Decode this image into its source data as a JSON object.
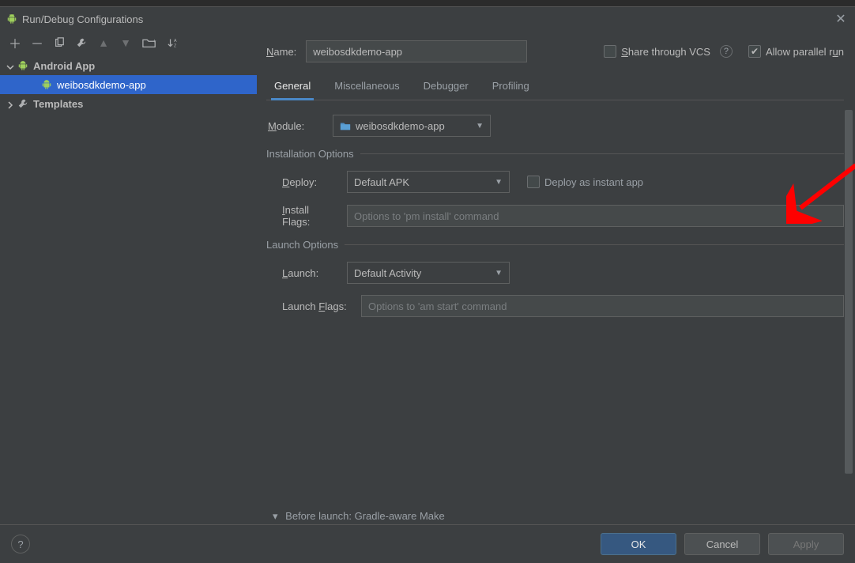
{
  "window": {
    "title": "Run/Debug Configurations"
  },
  "toolbar": {},
  "tree": {
    "group_label": "Android App",
    "selected_item": "weibosdkdemo-app",
    "templates_label": "Templates"
  },
  "name_field": {
    "label": "Name:",
    "value": "weibosdkdemo-app"
  },
  "share_vcs_label": "Share through VCS",
  "allow_parallel_label": "Allow parallel run",
  "allow_parallel_checked": true,
  "tabs": {
    "items": [
      "General",
      "Miscellaneous",
      "Debugger",
      "Profiling"
    ],
    "active_index": 0
  },
  "module": {
    "label": "Module:",
    "value": "weibosdkdemo-app"
  },
  "installation": {
    "header": "Installation Options",
    "deploy_label": "Deploy:",
    "deploy_value": "Default APK",
    "instant_app_label": "Deploy as instant app",
    "install_flags_label": "Install Flags:",
    "install_flags_placeholder": "Options to 'pm install' command"
  },
  "launch": {
    "header": "Launch Options",
    "launch_label": "Launch:",
    "launch_value": "Default Activity",
    "launch_flags_label": "Launch Flags:",
    "launch_flags_placeholder": "Options to 'am start' command"
  },
  "before_launch": "Before launch: Gradle-aware Make",
  "footer": {
    "ok": "OK",
    "cancel": "Cancel",
    "apply": "Apply"
  }
}
